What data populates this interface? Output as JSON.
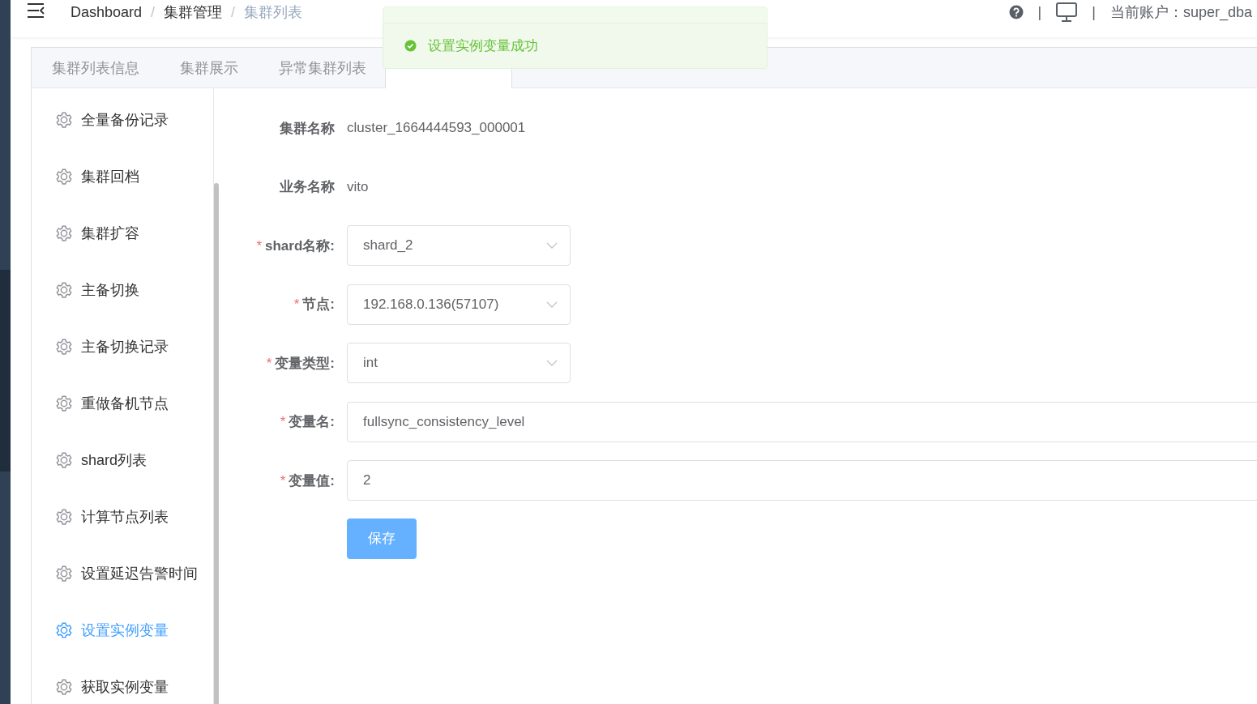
{
  "header": {
    "breadcrumbs": [
      {
        "label": "Dashboard",
        "current": false
      },
      {
        "label": "集群管理",
        "current": false
      },
      {
        "label": "集群列表",
        "current": true
      }
    ],
    "separator": "/",
    "divider": "|",
    "account": "当前账户：super_dba"
  },
  "toast": {
    "message": "设置实例变量成功"
  },
  "tabs": [
    {
      "label": "集群列表信息",
      "selected": false
    },
    {
      "label": "集群展示",
      "selected": false
    },
    {
      "label": "异常集群列表",
      "selected": false
    },
    {
      "selected": true
    }
  ],
  "menu": {
    "items": [
      {
        "label": "全量备份记录",
        "selected": false
      },
      {
        "label": "集群回档",
        "selected": false
      },
      {
        "label": "集群扩容",
        "selected": false
      },
      {
        "label": "主备切换",
        "selected": false
      },
      {
        "label": "主备切换记录",
        "selected": false
      },
      {
        "label": "重做备机节点",
        "selected": false
      },
      {
        "label": "shard列表",
        "selected": false
      },
      {
        "label": "计算节点列表",
        "selected": false
      },
      {
        "label": "设置延迟告警时间",
        "selected": false
      },
      {
        "label": "设置实例变量",
        "selected": true
      },
      {
        "label": "获取实例变量",
        "selected": false
      }
    ]
  },
  "form": {
    "fields": [
      {
        "kind": "text",
        "label": "集群名称",
        "value": "cluster_1664444593_000001",
        "required": false
      },
      {
        "kind": "text",
        "label": "业务名称",
        "value": "vito",
        "required": false
      },
      {
        "kind": "select",
        "label": "shard名称:",
        "value": "shard_2",
        "required": true
      },
      {
        "kind": "select",
        "label": "节点:",
        "value": "192.168.0.136(57107)",
        "required": true
      },
      {
        "kind": "select",
        "label": "变量类型:",
        "value": "int",
        "required": true
      },
      {
        "kind": "input",
        "label": "变量名:",
        "value": "fullsync_consistency_level",
        "required": true
      },
      {
        "kind": "input",
        "label": "变量值:",
        "value": "2",
        "required": true
      }
    ],
    "required_mark": "*",
    "submit": "保存"
  }
}
